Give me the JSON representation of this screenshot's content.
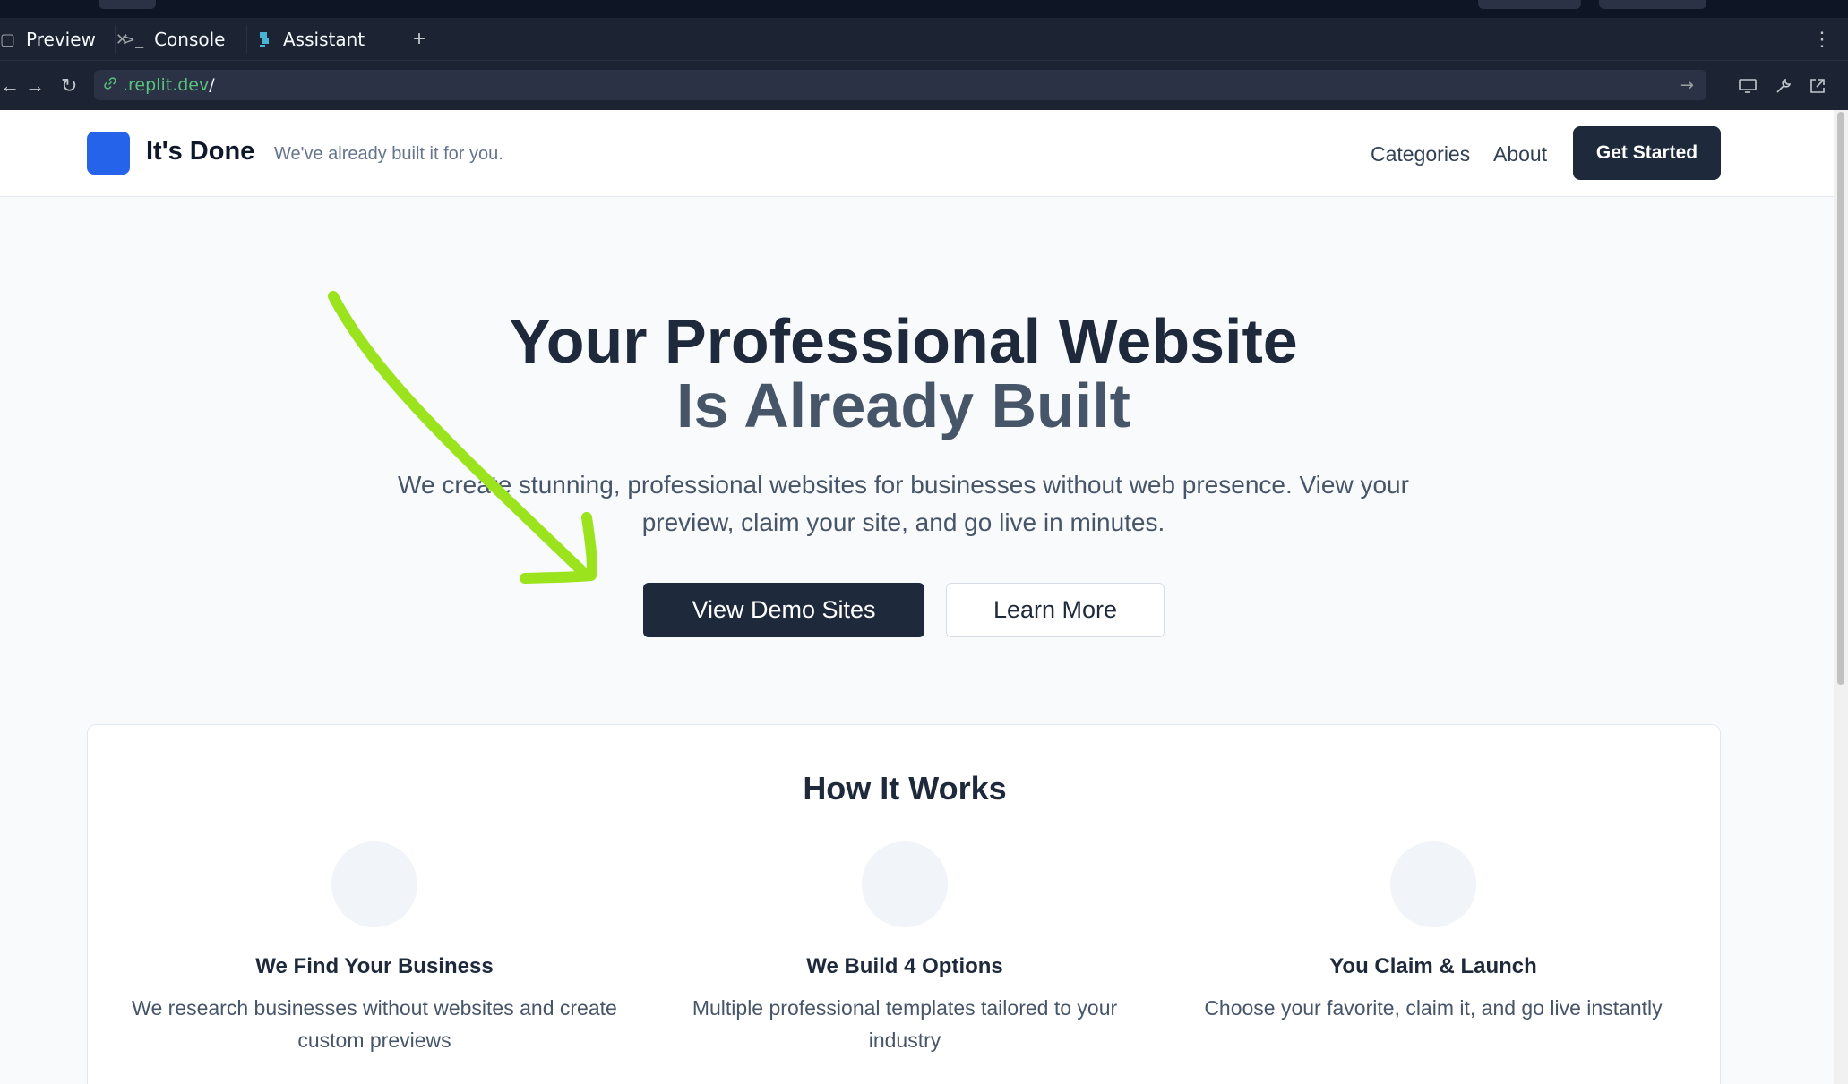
{
  "ide": {
    "tabs": [
      {
        "label": "Preview",
        "icon": "preview-icon",
        "closable": true
      },
      {
        "label": "Console",
        "icon": "terminal-icon"
      },
      {
        "label": "Assistant",
        "icon": "assistant-icon"
      }
    ],
    "new_tab_label": "+",
    "url": {
      "domain": ".replit.dev",
      "path": "/"
    }
  },
  "site": {
    "brand": "It's Done",
    "tagline": "We've already built it for you.",
    "nav": {
      "categories": "Categories",
      "about": "About",
      "cta": "Get Started"
    },
    "hero": {
      "title_line1": "Your Professional Website",
      "title_line2": "Is Already Built",
      "subtitle": "We create stunning, professional websites for businesses without web presence. View your preview, claim your site, and go live in minutes.",
      "primary_button": "View Demo Sites",
      "secondary_button": "Learn More"
    },
    "how_it_works": {
      "title": "How It Works",
      "steps": [
        {
          "title": "We Find Your Business",
          "description": "We research businesses without websites and create custom previews"
        },
        {
          "title": "We Build 4 Options",
          "description": "Multiple professional templates tailored to your industry"
        },
        {
          "title": "You Claim & Launch",
          "description": "Choose your favorite, claim it, and go live instantly"
        }
      ]
    }
  },
  "colors": {
    "accent": "#2563eb",
    "dark": "#1e293b",
    "annotation_arrow": "#9be31d"
  }
}
